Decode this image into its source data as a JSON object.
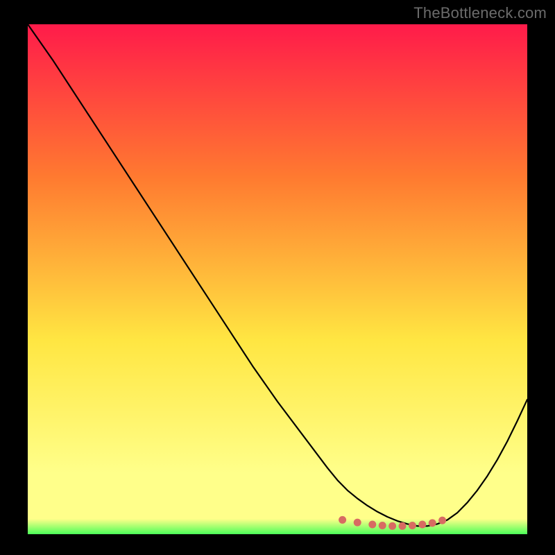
{
  "watermark": "TheBottleneck.com",
  "colors": {
    "frame": "#000000",
    "gradient_top": "#ff1b4a",
    "gradient_mid1": "#ff7a30",
    "gradient_mid2": "#ffe642",
    "gradient_low": "#ffff8a",
    "gradient_bottom": "#4bff58",
    "curve": "#000000",
    "dots": "#d86b62"
  },
  "chart_data": {
    "type": "line",
    "title": "",
    "xlabel": "",
    "ylabel": "",
    "xlim": [
      0,
      100
    ],
    "ylim": [
      0,
      100
    ],
    "grid": false,
    "x": [
      0,
      5,
      10,
      15,
      20,
      25,
      30,
      35,
      40,
      45,
      50,
      55,
      60,
      62,
      64,
      66,
      68,
      70,
      72,
      74,
      76,
      78,
      80,
      82,
      84,
      86,
      88,
      90,
      92,
      94,
      96,
      98,
      100
    ],
    "values": [
      100,
      93,
      85.5,
      78,
      70.5,
      63,
      55.5,
      48,
      40.5,
      33,
      26,
      19.5,
      13,
      10.6,
      8.6,
      7,
      5.6,
      4.4,
      3.4,
      2.6,
      2,
      1.6,
      1.6,
      2,
      2.8,
      4.2,
      6.2,
      8.6,
      11.4,
      14.6,
      18.2,
      22.2,
      26.4
    ],
    "dot_points": {
      "x": [
        63,
        66,
        69,
        71,
        73,
        75,
        77,
        79,
        81,
        83
      ],
      "y": [
        2.8,
        2.3,
        1.9,
        1.7,
        1.6,
        1.6,
        1.7,
        1.9,
        2.2,
        2.7
      ]
    }
  }
}
